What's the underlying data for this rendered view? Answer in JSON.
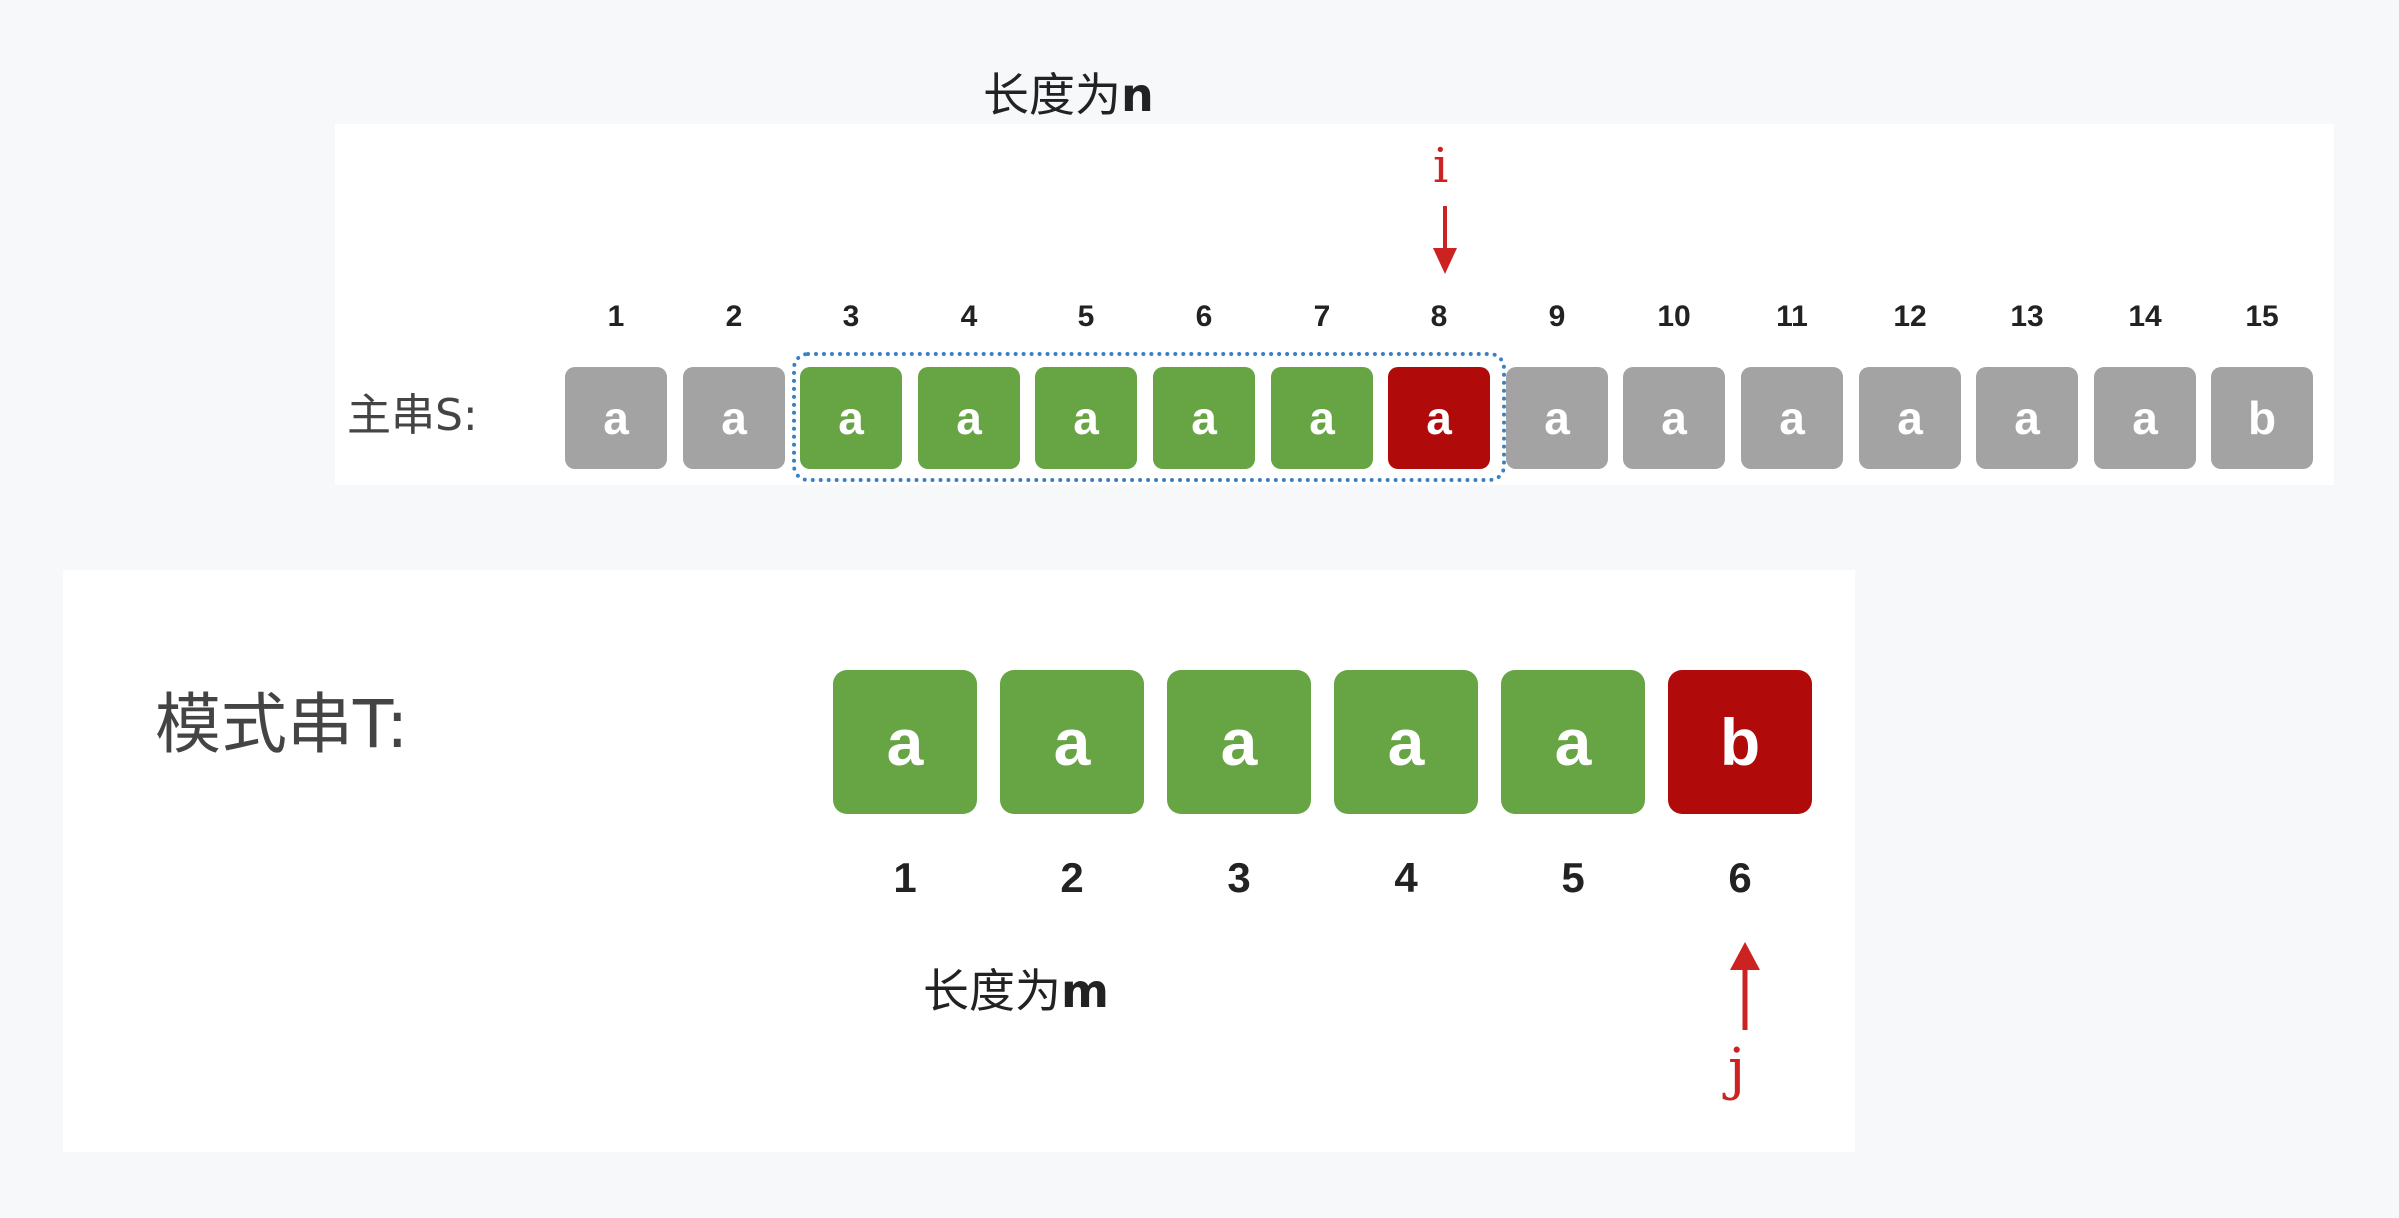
{
  "top_caption": {
    "text": "长度为",
    "var": "n"
  },
  "main_string": {
    "label": "主串S:",
    "indices": [
      "1",
      "2",
      "3",
      "4",
      "5",
      "6",
      "7",
      "8",
      "9",
      "10",
      "11",
      "12",
      "13",
      "14",
      "15"
    ],
    "chars": [
      "a",
      "a",
      "a",
      "a",
      "a",
      "a",
      "a",
      "a",
      "a",
      "a",
      "a",
      "a",
      "a",
      "a",
      "b"
    ],
    "states": [
      "gray",
      "gray",
      "green",
      "green",
      "green",
      "green",
      "green",
      "red",
      "gray",
      "gray",
      "gray",
      "gray",
      "gray",
      "gray",
      "gray"
    ],
    "pointer": {
      "label": "i",
      "index": 8
    },
    "highlight_range": [
      3,
      8
    ]
  },
  "pattern_string": {
    "label": "模式串T:",
    "indices": [
      "1",
      "2",
      "3",
      "4",
      "5",
      "6"
    ],
    "chars": [
      "a",
      "a",
      "a",
      "a",
      "a",
      "b"
    ],
    "states": [
      "green",
      "green",
      "green",
      "green",
      "green",
      "red"
    ],
    "pointer": {
      "label": "j",
      "index": 6
    }
  },
  "bottom_caption": {
    "text": "长度为",
    "var": "m"
  },
  "colors": {
    "gray": "#a3a3a3",
    "green": "#66a444",
    "red": "#b10a0a",
    "pointer": "#cc2222",
    "dotted": "#3b7fc4"
  }
}
